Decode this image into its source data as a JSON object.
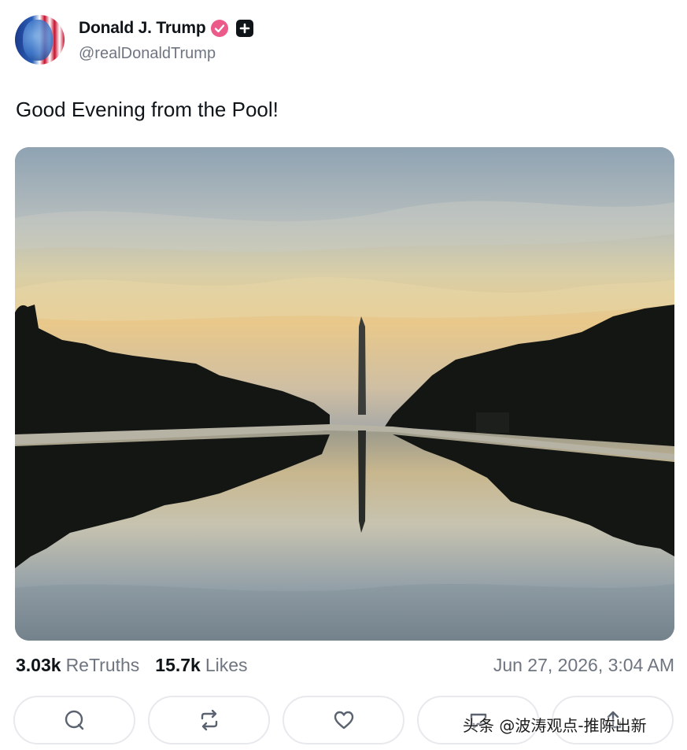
{
  "author": {
    "name": "Donald J. Trump",
    "handle": "@realDonaldTrump",
    "verified_color": "#ec5a8a"
  },
  "post": {
    "text": "Good Evening from the Pool!",
    "image_alt_icon": "photo-icon"
  },
  "stats": {
    "retruths_count": "3.03k",
    "retruths_label": "ReTruths",
    "likes_count": "15.7k",
    "likes_label": "Likes",
    "timestamp": "Jun 27, 2026, 3:04 AM"
  },
  "actions": [
    {
      "icon": "reply-icon"
    },
    {
      "icon": "retruth-icon"
    },
    {
      "icon": "heart-icon"
    },
    {
      "icon": "quote-icon"
    },
    {
      "icon": "share-icon"
    }
  ],
  "watermark": "头条 @波涛观点-推陈出新"
}
